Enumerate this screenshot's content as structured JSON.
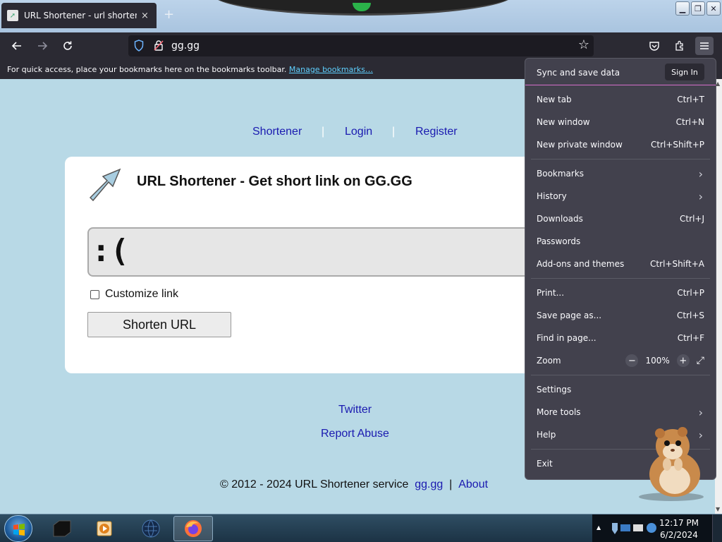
{
  "browser": {
    "tab": {
      "title": "URL Shortener - url shortening",
      "close": "×"
    },
    "new_tab": "+",
    "window_buttons": {
      "minimize": "▁",
      "restore": "❐",
      "close": "✕"
    },
    "url": "gg.gg",
    "bookmarks_bar": {
      "text": "For quick access, place your bookmarks here on the bookmarks toolbar.",
      "link": "Manage bookmarks…"
    }
  },
  "site": {
    "nav": [
      "Shortener",
      "Login",
      "Register"
    ],
    "nav_sep": "|",
    "heading": "URL Shortener - Get short link on GG.GG",
    "input_value": ":(",
    "customize_label": "Customize link",
    "shorten_button": "Shorten URL",
    "footer_links": {
      "twitter": "Twitter",
      "report": "Report Abuse"
    },
    "copyright": "© 2012 - 2024 URL Shortener service",
    "copyright_link1": "gg.gg",
    "copyright_sep": "|",
    "copyright_link2": "About"
  },
  "app_menu": {
    "sync_label": "Sync and save data",
    "sign_in": "Sign In",
    "items": [
      {
        "label": "New tab",
        "shortcut": "Ctrl+T"
      },
      {
        "label": "New window",
        "shortcut": "Ctrl+N"
      },
      {
        "label": "New private window",
        "shortcut": "Ctrl+Shift+P"
      },
      {
        "label": "Bookmarks",
        "shortcut": ""
      },
      {
        "label": "History",
        "shortcut": ""
      },
      {
        "label": "Downloads",
        "shortcut": "Ctrl+J"
      },
      {
        "label": "Passwords",
        "shortcut": ""
      },
      {
        "label": "Add-ons and themes",
        "shortcut": "Ctrl+Shift+A"
      },
      {
        "label": "Print...",
        "shortcut": "Ctrl+P"
      },
      {
        "label": "Save page as...",
        "shortcut": "Ctrl+S"
      },
      {
        "label": "Find in page...",
        "shortcut": "Ctrl+F"
      },
      {
        "label": "Zoom",
        "shortcut": ""
      },
      {
        "label": "Settings",
        "shortcut": ""
      },
      {
        "label": "More tools",
        "shortcut": ""
      },
      {
        "label": "Help",
        "shortcut": ""
      },
      {
        "label": "Exit",
        "shortcut": ""
      }
    ],
    "zoom": {
      "minus": "−",
      "value": "100%",
      "plus": "+"
    }
  },
  "taskbar": {
    "time": "12:17 PM",
    "date": "6/2/2024"
  },
  "colors": {
    "page_bg": "#b8d9e6",
    "toolbar_bg": "#2b2a33",
    "menu_bg": "#42414d",
    "link": "#1a1ab0"
  }
}
